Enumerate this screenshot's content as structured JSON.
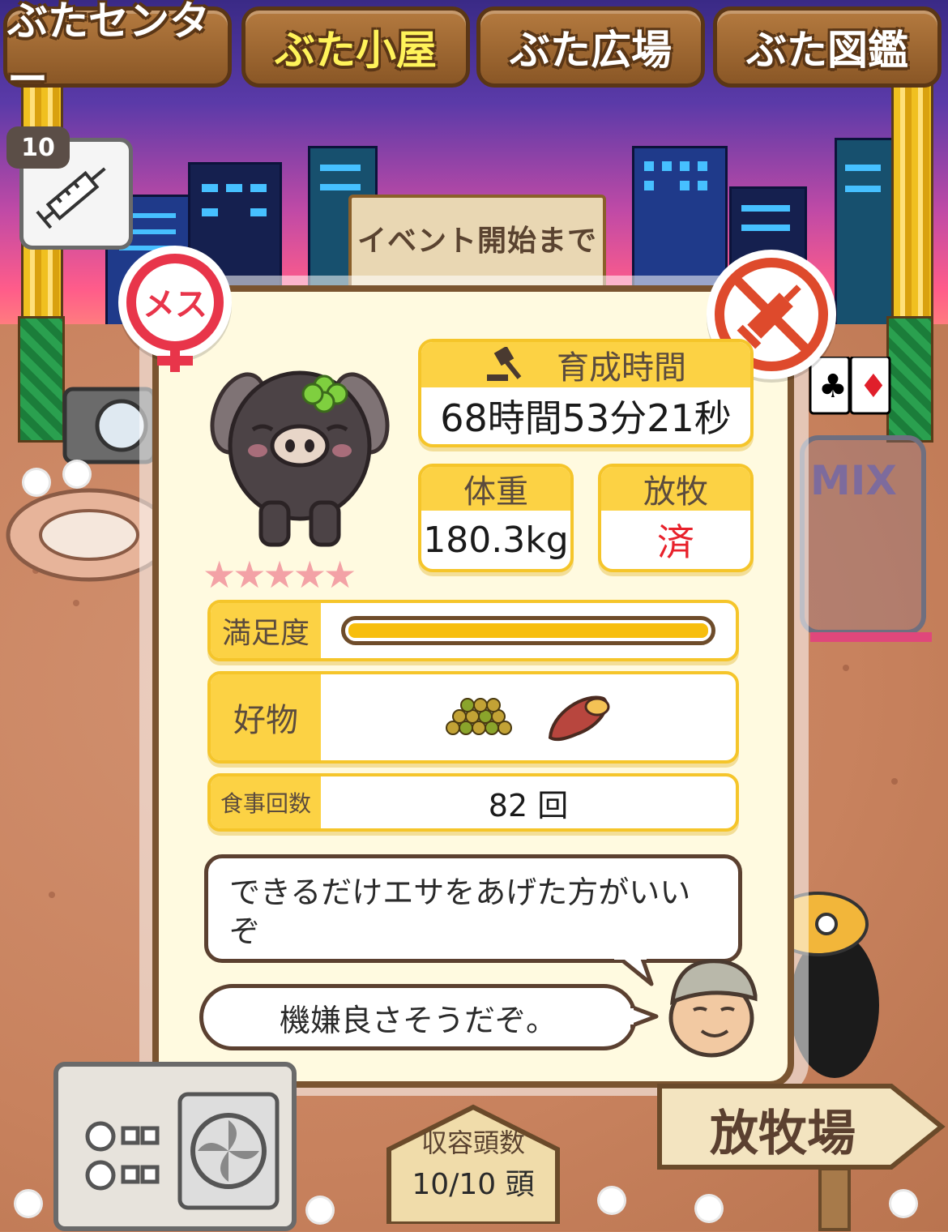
{
  "nav": {
    "tabs": [
      {
        "label": "ぶたセンター",
        "active": false
      },
      {
        "label": "ぶた小屋",
        "active": true
      },
      {
        "label": "ぶた広場",
        "active": false
      },
      {
        "label": "ぶた図鑑",
        "active": false
      }
    ]
  },
  "syringe": {
    "count": "10",
    "icon": "syringe-icon"
  },
  "event_sign": {
    "text": "イベント開始まで"
  },
  "pig": {
    "gender_badge": "メス",
    "vaccine_icon": "no-syringe-icon",
    "stars": "★★★★★",
    "star_count": 5,
    "growth_time_label": "育成時間",
    "growth_time_icon": "hammer-icon",
    "growth_time_value": "68時間53分21秒",
    "weight_label": "体重",
    "weight_value": "180.3kg",
    "grazing_label": "放牧",
    "grazing_value": "済",
    "satisfaction_label": "満足度",
    "satisfaction_level": 1.0,
    "favorites_label": "好物",
    "favorites": [
      "beans-icon",
      "sweet-potato-icon"
    ],
    "meals_label": "食事回数",
    "meals_value": "82 回",
    "advice": "できるだけエサをあげた方がいいぞ",
    "mood": "機嫌良さそうだぞ。"
  },
  "bottom": {
    "capacity_label": "収容頭数",
    "capacity_value": "10/10 頭",
    "ranch_label": "放牧場"
  },
  "colors": {
    "accent_yellow": "#fcd244",
    "card_border": "#7a5430",
    "grazing_done": "#e8212b",
    "star": "#f3a2a6",
    "gender": "#e8354a"
  }
}
